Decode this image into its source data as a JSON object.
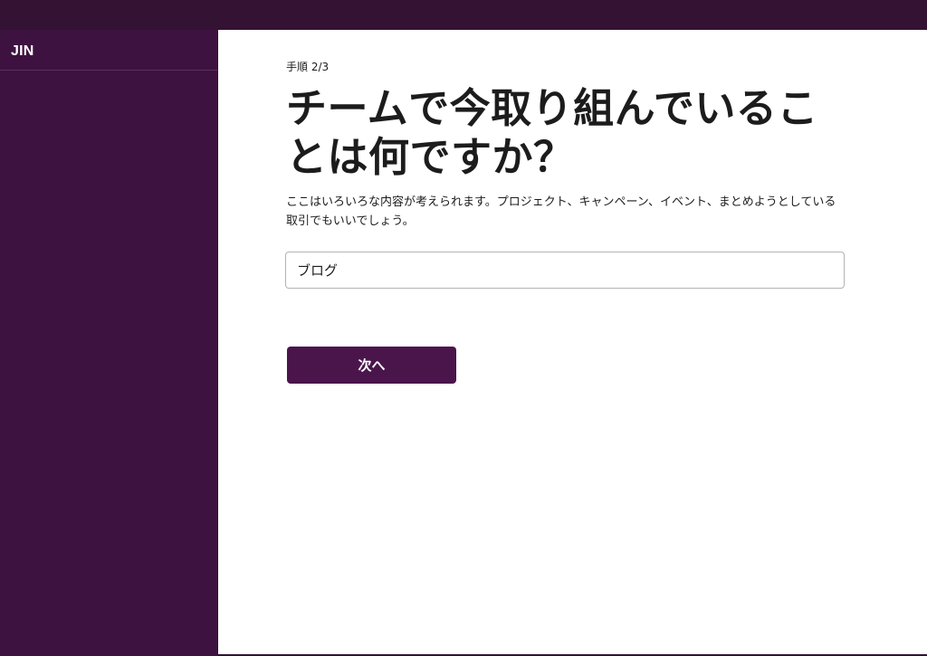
{
  "sidebar": {
    "workspace_name": "JIN"
  },
  "main": {
    "step_label": "手順 2/3",
    "title": "チームで今取り組んでいることは何ですか？",
    "description": "ここはいろいろな内容が考えられます。プロジェクト、キャンペーン、イベント、まとめようとしている取引でもいいでしょう。",
    "input": {
      "value": "ブログ",
      "placeholder": ""
    },
    "next_button_label": "次へ"
  },
  "colors": {
    "sidebar_bg": "#3e1240",
    "topbar_bg": "#341233",
    "button_bg": "#4a154b"
  }
}
